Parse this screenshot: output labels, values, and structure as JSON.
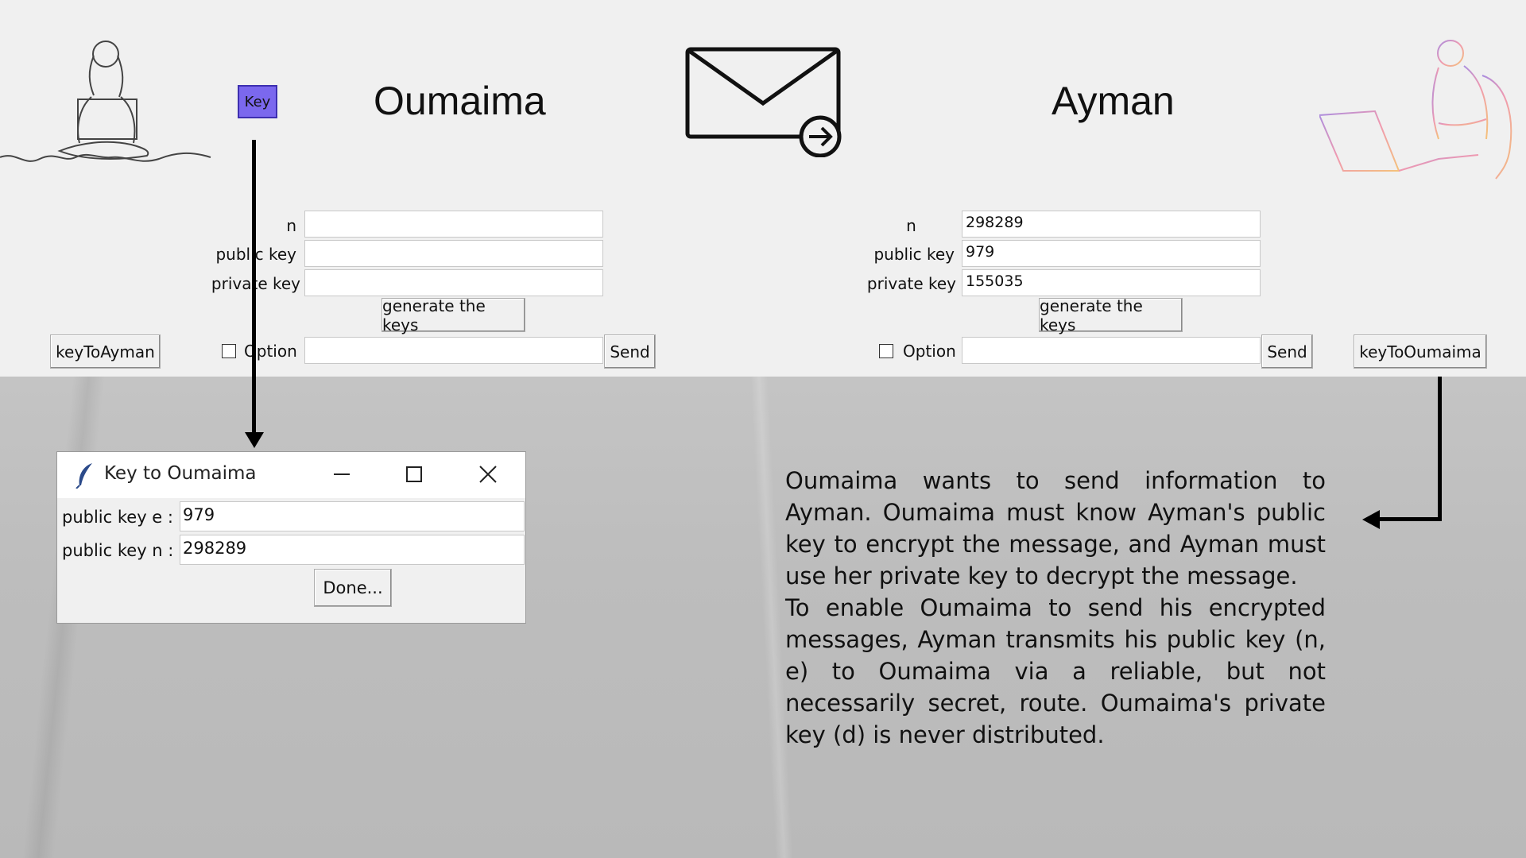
{
  "left_panel": {
    "name": "Oumaima",
    "key_button": "Key",
    "fields": [
      {
        "label": "n",
        "value": ""
      },
      {
        "label": "public key",
        "value": ""
      },
      {
        "label": "private key",
        "value": ""
      }
    ],
    "generate_label": "generate the keys",
    "option_label": "Option",
    "message_value": "",
    "send_label": "Send",
    "transfer_button": "keyToAyman"
  },
  "right_panel": {
    "name": "Ayman",
    "fields": [
      {
        "label": "n",
        "value": "298289"
      },
      {
        "label": "public key",
        "value": "979"
      },
      {
        "label": "private key",
        "value": "155035"
      }
    ],
    "generate_label": "generate the keys",
    "option_label": "Option",
    "message_value": "",
    "send_label": "Send",
    "transfer_button": "keyToOumaima"
  },
  "dialog": {
    "title": "Key to Oumaima",
    "fields": [
      {
        "label": "public key e :",
        "value": "979"
      },
      {
        "label": "public key n :",
        "value": "298289"
      }
    ],
    "done_label": "Done...",
    "icons": [
      "feather-icon",
      "minimize-icon",
      "maximize-icon",
      "close-icon"
    ]
  },
  "description": {
    "paragraph1": "Oumaima wants to send information to Ayman. Oumaima must know Ayman's public key to encrypt the message, and Ayman must use her private key to decrypt the message.",
    "paragraph2": "To enable Oumaima to send his encrypted messages, Ayman transmits his public key (n, e) to Oumaima via a reliable, but not necessarily secret, route. Oumaima's private key (d) is never distributed."
  },
  "colors": {
    "key_button": "#7b68ee",
    "app_background": "#f0f0f0",
    "paper_background": "#bdbdbd"
  }
}
